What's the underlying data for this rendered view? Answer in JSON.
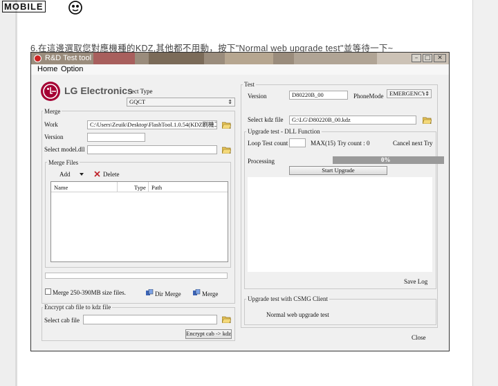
{
  "site": {
    "logo_text": "MOBILE",
    "logo_suffix": "01"
  },
  "caption": "6.在這邊選取您對應機種的KDZ,其他都不用動，按下\"Normal web upgrade test\"並等待一下~",
  "window": {
    "title": "R&D Test tool",
    "menu": [
      "Home",
      "Option"
    ],
    "controls": {
      "minimize": "–",
      "maximize": "□",
      "close": "✕"
    }
  },
  "left": {
    "brand": "LG Electronics",
    "select_type_label": "ect Type",
    "select_type_value": "GQCT",
    "merge": {
      "group_label": "Merge",
      "work_label": "Work",
      "work_value": "C:\\Users\\Zeuik\\Desktop\\FlashTool.1.0.54(KDZ刷機工具",
      "version_label": "Version",
      "version_value": "",
      "model_dll_label": "Select model.dll",
      "model_dll_value": "",
      "merge_files": {
        "group_label": "Merge Files",
        "add_label": "Add",
        "delete_label": "Delete",
        "columns": [
          "Name",
          "Type",
          "Path"
        ]
      },
      "size_check_label": "Merge 250-390MB size files.",
      "dir_merge_label": "Dir Merge",
      "merge_label": "Merge"
    },
    "encrypt": {
      "group_label": "Encrypt cab file to kdz file",
      "select_cab_label": "Select cab file",
      "select_cab_value": "",
      "button_label": "Encrypt cab -> kdz"
    }
  },
  "right": {
    "test": {
      "group_label": "Test",
      "version_label": "Version",
      "version_value": "D80220B_00",
      "phone_mode_label": "PhoneMode",
      "phone_mode_value": "EMERGENCY",
      "kdz_label": "Select kdz file",
      "kdz_value": "G:\\LG\\D80220B_00.kdz"
    },
    "upgrade": {
      "group_label": "Upgrade test - DLL Function",
      "loop_label": "Loop Test count",
      "loop_value": "",
      "max_label": "MAX(15)",
      "try_label": "Try count :",
      "try_value": "0",
      "cancel_label": "Cancel next Try",
      "processing_label": "Processing",
      "progress_percent": 0,
      "progress_text": "0%",
      "start_label": "Start Upgrade",
      "save_log_label": "Save Log"
    },
    "csmg": {
      "group_label": "Upgrade test with CSMG Client",
      "normal_label": "Normal web upgrade test"
    },
    "close_label": "Close"
  },
  "colors": {
    "lg_red": "#a50034",
    "window_bg": "#f0f0f0",
    "progress_fill": "#9a9a9a"
  }
}
